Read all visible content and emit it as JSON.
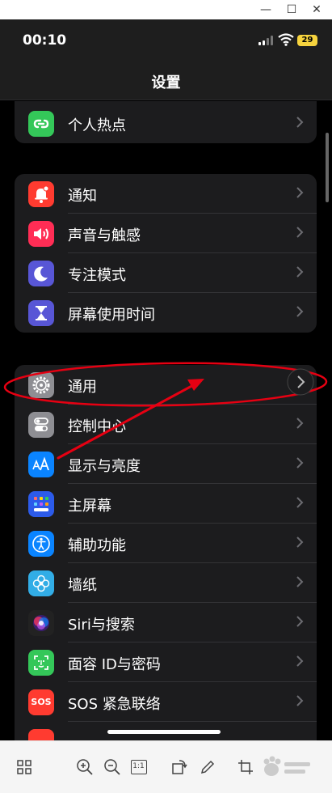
{
  "status_bar": {
    "time": "00:10",
    "battery": "29"
  },
  "nav": {
    "title": "设置"
  },
  "groups": [
    {
      "items": [
        {
          "label": "个人热点",
          "icon": "hotspot-icon",
          "color": "#34c759"
        }
      ]
    },
    {
      "items": [
        {
          "label": "通知",
          "icon": "bell-icon",
          "color": "#ff3b30"
        },
        {
          "label": "声音与触感",
          "icon": "speaker-icon",
          "color": "#ff2d55"
        },
        {
          "label": "专注模式",
          "icon": "moon-icon",
          "color": "#5856d6"
        },
        {
          "label": "屏幕使用时间",
          "icon": "hourglass-icon",
          "color": "#5856d6"
        }
      ]
    },
    {
      "items": [
        {
          "label": "通用",
          "icon": "gear-icon",
          "color": "#8e8e93"
        },
        {
          "label": "控制中心",
          "icon": "toggles-icon",
          "color": "#8e8e93"
        },
        {
          "label": "显示与亮度",
          "icon": "text-size-icon",
          "color": "#0a84ff"
        },
        {
          "label": "主屏幕",
          "icon": "home-grid-icon",
          "color": "#2c5bea"
        },
        {
          "label": "辅助功能",
          "icon": "accessibility-icon",
          "color": "#0a84ff"
        },
        {
          "label": "墙纸",
          "icon": "flower-icon",
          "color": "#32ade6"
        },
        {
          "label": "Siri与搜索",
          "icon": "siri-icon",
          "color": "#222222"
        },
        {
          "label": "面容 ID与密码",
          "icon": "face-id-icon",
          "color": "#34c759"
        },
        {
          "label": "SOS 紧急联络",
          "icon": "sos-icon",
          "color": "#ff3b30"
        }
      ]
    }
  ],
  "sos_icon_text": "SOS",
  "toolbar": {
    "actual_size_label": "1:1"
  }
}
